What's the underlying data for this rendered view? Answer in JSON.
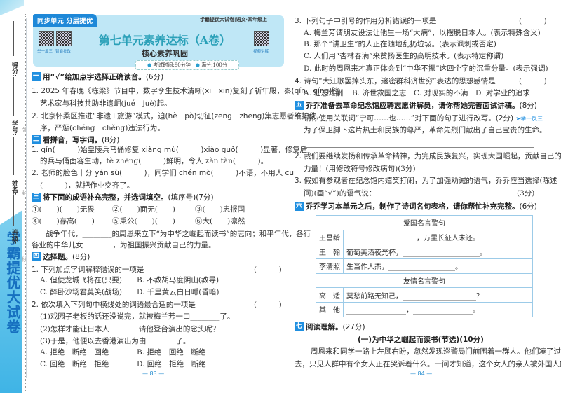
{
  "side": {
    "labels": [
      "得分:",
      "学号:",
      "姓名:",
      "班级:"
    ],
    "seal": [
      "弥",
      "封",
      "线"
    ],
    "brand": "学霸提优大试卷"
  },
  "header": {
    "tab": "同步单元 分层提优",
    "series": "学霸提优大试卷|语文·四年级上",
    "title": "第七单元素养达标（A卷）",
    "subtitle": "核心素养巩固",
    "qr_labels": [
      "举一反三",
      "智能批改",
      "视频讲解"
    ],
    "time": "考试时间:90分钟",
    "score": "满分:100分"
  },
  "left": {
    "s1": {
      "num": "一",
      "title": "用“√”给加点字选择正确读音。",
      "pts": "(6分)",
      "lines": [
        "1. 2025 年春晚《栋梁》节目中，数字孪生技术清晰(xī　xīn)复刻了祈年殿，秦(qín　qíng)腔",
        "艺术家与科技共助非遗崛(jué　juè)起。",
        "2. 北京怀柔区推进“非遗+旅游”模式，迫(hè　pò)切征(zēng　zhēng)集志愿者维护秩",
        "序，严惩(chéng　chěng)违法行为。"
      ]
    },
    "s2": {
      "num": "二",
      "title": "看拼音，写字词。",
      "pts": "(8分)",
      "lines": [
        "1. qín(　　　)始皇陵兵马俑修复 xiàng mù(　　　)xiào guǒ(　　　)显著，修复后",
        "的兵马俑面容生动，tè zhēng(　　　)鲜明，令人 zàn tàn(　　　)。",
        "2. 老师的脸色十分 yán sù(　　　)，同学们 chén mò(　　　)不语，不用人 cuī",
        "(　　　)，就把作业交齐了。"
      ]
    },
    "s3": {
      "num": "三",
      "title": "将下面的成语补充完整，并选词填空。",
      "pts": "(填序号)(7分)",
      "idioms": [
        "①(　　)(　　)无畏",
        "②(　　)面无(　　)",
        "③(　　)忠报国",
        "④(　　)存高(　　)",
        "⑤秉公(　　)(　　)",
        "⑥大(　　)凛然"
      ],
      "lines": [
        "战争年代，________的周恩来立下“为中华之崛起而读书”的志向；和平年代，各行",
        "各业的中华儿女________，为祖国振兴贡献自己的力量。"
      ]
    },
    "s4": {
      "num": "四",
      "title": "选择题。",
      "pts": "(8分)",
      "q1": "1. 下列加点字词解释错误的一项是",
      "q1_opts": [
        "A. 但使龙城飞将在(只要)",
        "B. 不教胡马度阴山(教导)",
        "C. 醉卧沙场君莫笑(战场)",
        "D. 千里黄云白日曛(昏暗)"
      ],
      "q2": "2. 依次填入下列句中横线处的词语最合适的一项是",
      "q2_lines": [
        "(1)戏园子老板的话还没说完，就被梅兰芳一口________了。",
        "(2)怎样才能让日本人________请他登台演出的念头呢？",
        "(3)于是，他便以去香港演出为由________了。"
      ],
      "q2_opts": [
        "A. 拒绝　断绝　回绝",
        "B. 拒绝　回绝　断绝",
        "C. 回绝　断绝　拒绝",
        "D. 回绝　拒绝　断绝"
      ],
      "paren": "(　　　)"
    },
    "page": "— 83 —"
  },
  "right": {
    "s4b": {
      "q3": "3. 下列句子中引号的作用分析错误的一项是",
      "q3_opts": [
        "A. 梅兰芳请朋友设法让他生一场“大病”，以摆脱日本人。(表示特殊含义)",
        "B. 那个“讲卫生”的人正在随地乱扔垃圾。(表示讽刺或否定)",
        "C. 人们用“杏林春满”来赞扬医生的高明技术。(表示特定称谓)",
        "D. 此时的周恩来才真正体会到“中华不振”这四个字的沉重分量。(表示强调)"
      ],
      "q4": "4. 诗句“大江歌罢掉头东，邃密群科济世穷”表达的思想感情是",
      "q4_opts": [
        "A. 壮志难酬",
        "B. 济世救国之志",
        "C. 对现实的不满",
        "D. 对学业的追求"
      ],
      "paren": "(　　　)"
    },
    "s5": {
      "num": "五",
      "title": "乔乔准备去革命纪念馆应聘志愿讲解员，请你帮她完善面试讲稿。",
      "pts": "(8分)",
      "q1": "1. 请你使用关联词“宁可……也……”对下面的句子进行改写。(2分)",
      "q1_tag": "➤举一反三",
      "q1_text": "为了保卫脚下这片热土和民族的尊严，革命先烈们献出了自己宝贵的生命。",
      "q2": "2. 我们要继续发扬和传承革命精神，为完成民族复兴，实现大国崛起，贡献自己的一份",
      "q2b": "力量！(用修改符号修改病句)(3分)",
      "q3": "3. 假如有参观者在纪念馆内嬉笑打闹，为了加强劝诫的语气，乔乔应当选择(陈述　反",
      "q3b": "问)(画“√”)的语气说：",
      "q3_pts": "(3分)"
    },
    "s6": {
      "num": "六",
      "title": "乔乔学习本单元之后，制作了诗词名句表格，请你帮忙补充完整。",
      "pts": "(6分)",
      "table": {
        "h1": "爱国名言警句",
        "rows1": [
          [
            "王昌龄",
            "____________________，万里长征人未还。"
          ],
          [
            "王　翰",
            "葡萄美酒夜光杯，______________________。"
          ],
          [
            "李清照",
            "生当作人杰，___________________。"
          ]
        ],
        "h2": "友情名言警句",
        "rows2": [
          [
            "高　适",
            "莫愁前路无知己，_____________________？"
          ],
          [
            "其　他",
            "_________________，_________________。"
          ]
        ]
      }
    },
    "s7": {
      "num": "七",
      "title": "阅读理解。",
      "pts": "(27分)",
      "sub": "(一)为中华之崛起而读书(节选)(10分)",
      "lines": [
        "周恩来和同学一路上左顾右盼，忽然发现巡警局门前围着一群人。他们凑了过",
        "去，只见人群中有个女人正在哭诉着什么。一问才知道，这个女人的亲人被外国人的"
      ]
    },
    "page": "— 84 —"
  }
}
